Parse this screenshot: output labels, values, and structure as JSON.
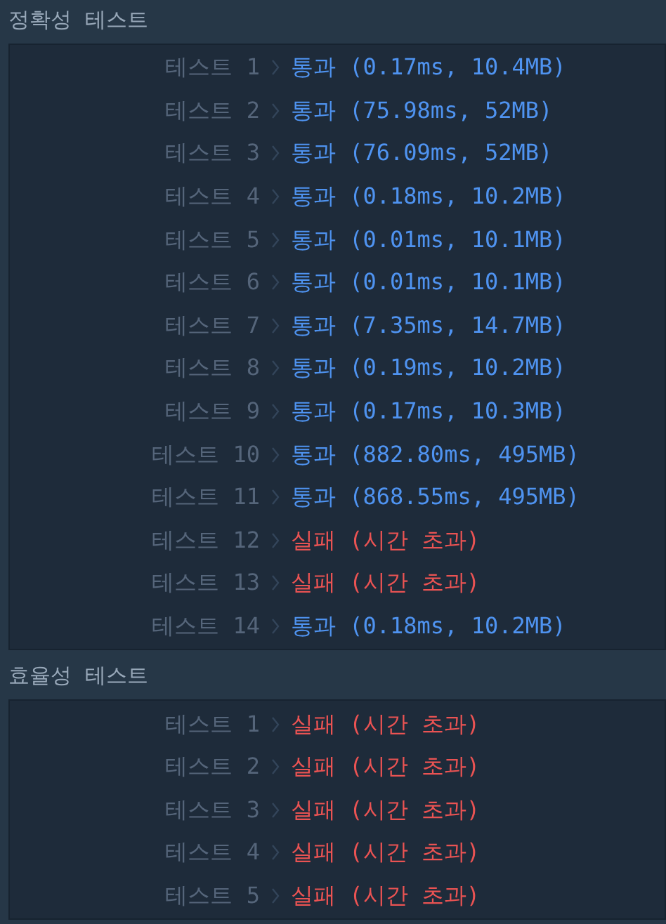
{
  "sections": [
    {
      "title": "정확성  테스트",
      "rows": [
        {
          "label": "테스트 1",
          "kind": "pass",
          "result": "통과 (0.17ms, 10.4MB)"
        },
        {
          "label": "테스트 2",
          "kind": "pass",
          "result": "통과 (75.98ms, 52MB)"
        },
        {
          "label": "테스트 3",
          "kind": "pass",
          "result": "통과 (76.09ms, 52MB)"
        },
        {
          "label": "테스트 4",
          "kind": "pass",
          "result": "통과 (0.18ms, 10.2MB)"
        },
        {
          "label": "테스트 5",
          "kind": "pass",
          "result": "통과 (0.01ms, 10.1MB)"
        },
        {
          "label": "테스트 6",
          "kind": "pass",
          "result": "통과 (0.01ms, 10.1MB)"
        },
        {
          "label": "테스트 7",
          "kind": "pass",
          "result": "통과 (7.35ms, 14.7MB)"
        },
        {
          "label": "테스트 8",
          "kind": "pass",
          "result": "통과 (0.19ms, 10.2MB)"
        },
        {
          "label": "테스트 9",
          "kind": "pass",
          "result": "통과 (0.17ms, 10.3MB)"
        },
        {
          "label": "테스트 10",
          "kind": "pass",
          "result": "통과 (882.80ms, 495MB)"
        },
        {
          "label": "테스트 11",
          "kind": "pass",
          "result": "통과 (868.55ms, 495MB)"
        },
        {
          "label": "테스트 12",
          "kind": "fail",
          "result": "실패 (시간 초과)"
        },
        {
          "label": "테스트 13",
          "kind": "fail",
          "result": "실패 (시간 초과)"
        },
        {
          "label": "테스트 14",
          "kind": "pass",
          "result": "통과 (0.18ms, 10.2MB)"
        }
      ]
    },
    {
      "title": "효율성  테스트",
      "rows": [
        {
          "label": "테스트 1",
          "kind": "fail",
          "result": "실패 (시간 초과)"
        },
        {
          "label": "테스트 2",
          "kind": "fail",
          "result": "실패 (시간 초과)"
        },
        {
          "label": "테스트 3",
          "kind": "fail",
          "result": "실패 (시간 초과)"
        },
        {
          "label": "테스트 4",
          "kind": "fail",
          "result": "실패 (시간 초과)"
        },
        {
          "label": "테스트 5",
          "kind": "fail",
          "result": "실패 (시간 초과)"
        }
      ]
    }
  ]
}
